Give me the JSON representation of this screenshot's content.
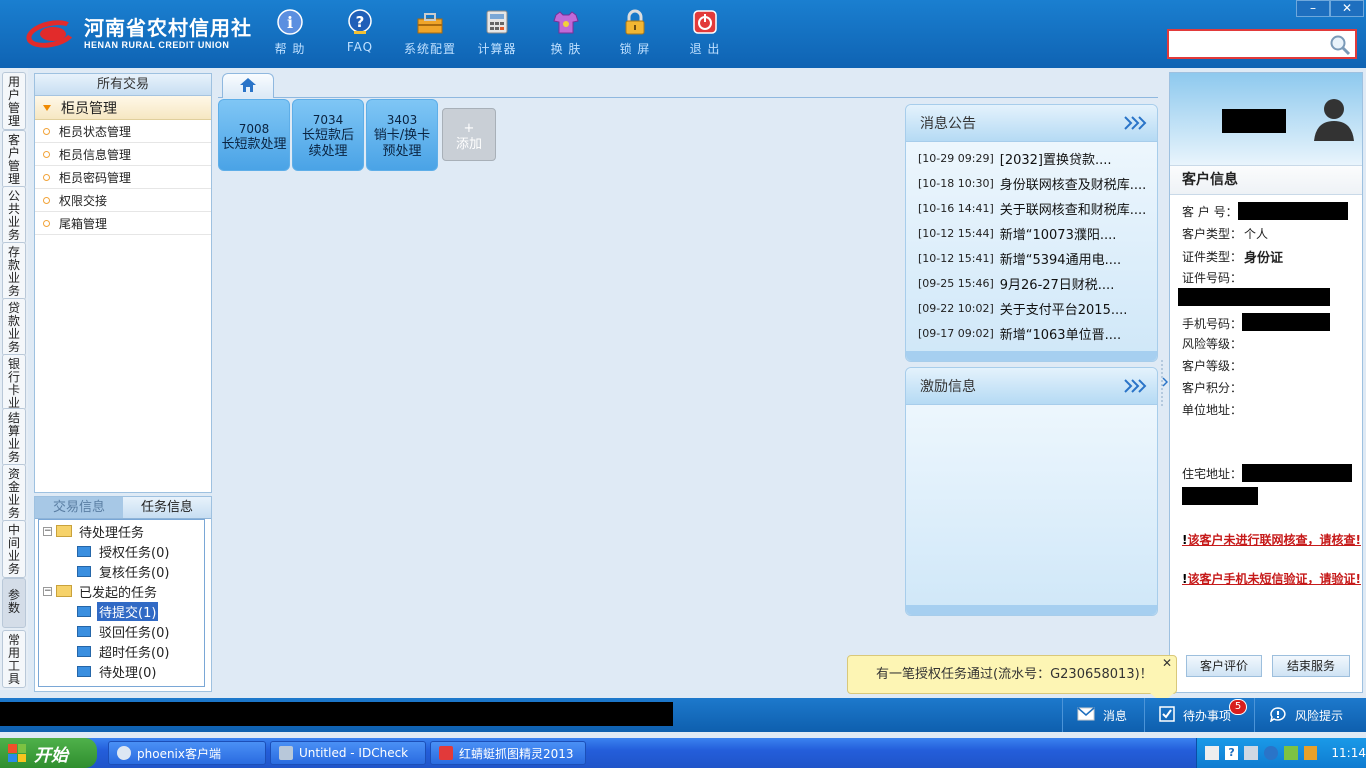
{
  "header": {
    "logo_cn": "河南省农村信用社",
    "logo_en": "HENAN RURAL CREDIT UNION",
    "tools": [
      {
        "label": "帮 助",
        "icon": "info-icon"
      },
      {
        "label": "FAQ",
        "icon": "help-icon"
      },
      {
        "label": "系统配置",
        "icon": "toolbox-icon"
      },
      {
        "label": "计算器",
        "icon": "calculator-icon"
      },
      {
        "label": "换 肤",
        "icon": "shirt-icon"
      },
      {
        "label": "锁 屏",
        "icon": "lock-icon"
      },
      {
        "label": "退 出",
        "icon": "power-icon"
      }
    ],
    "minimize": "–",
    "close": "✕",
    "search_value": ""
  },
  "vtabs": [
    "用户管理",
    "客户管理",
    "公共业务",
    "存款业务",
    "贷款业务",
    "银行卡业务",
    "结算业务",
    "资金业务",
    "中间业务",
    "参数",
    "常用工具"
  ],
  "left_menu": {
    "header": "所有交易",
    "group": "柜员管理",
    "items": [
      "柜员状态管理",
      "柜员信息管理",
      "柜员密码管理",
      "权限交接",
      "尾箱管理"
    ]
  },
  "tasks": {
    "tab_tx": "交易信息",
    "tab_task": "任务信息",
    "pending": "待处理任务",
    "auth": "授权任务(0)",
    "review": "复核任务(0)",
    "initiated": "已发起的任务",
    "to_submit": "待提交(1)",
    "rejected": "驳回任务(0)",
    "timeout": "超时任务(0)",
    "to_process": "待处理(0)"
  },
  "tiles": [
    {
      "code": "7008",
      "name": "长短款处理"
    },
    {
      "code": "7034",
      "name": "长短款后续处理"
    },
    {
      "code": "3403",
      "name": "销卡/换卡预处理"
    }
  ],
  "add_tile": {
    "plus": "+",
    "label": "添加"
  },
  "notices": {
    "title": "消息公告",
    "items": [
      {
        "date": "[10-29 09:29]",
        "text": "[2032]置换贷款...."
      },
      {
        "date": "[10-18 10:30]",
        "text": "身份联网核查及财税库...."
      },
      {
        "date": "[10-16 14:41]",
        "text": "关于联网核查和财税库...."
      },
      {
        "date": "[10-12 15:44]",
        "text": "新增“10073濮阳...."
      },
      {
        "date": "[10-12 15:41]",
        "text": "新增“5394通用电...."
      },
      {
        "date": "[09-25 15:46]",
        "text": "9月26-27日财税...."
      },
      {
        "date": "[09-22 10:02]",
        "text": "关于支付平台2015...."
      },
      {
        "date": "[09-17 09:02]",
        "text": "新增“1063单位晋...."
      }
    ]
  },
  "incentive": {
    "title": "激励信息"
  },
  "customer": {
    "title": "客户信息",
    "no_label": "客 户 号：",
    "type_label": "客户类型：",
    "type_value": "个人",
    "id_type_label": "证件类型：",
    "id_type_value": "身份证",
    "id_no_label": "证件号码：",
    "phone_label": "手机号码：",
    "risk_label": "风险等级：",
    "level_label": "客户等级：",
    "points_label": "客户积分：",
    "work_addr_label": "单位地址：",
    "home_addr_label": "住宅地址：",
    "warn1": "该客户未进行联网核查，请核查",
    "warn2": "该客户手机未短信验证，请验证",
    "excl": "!",
    "bang": "!",
    "eval_btn": "客户评价",
    "end_btn": "结束服务"
  },
  "toast": {
    "text": "有一笔授权任务通过(流水号：G230658013)！",
    "close": "✕"
  },
  "statusbar": {
    "msg": "消息",
    "todo": "待办事项",
    "todo_count": "5",
    "risk": "风险提示"
  },
  "taskbar": {
    "start": "开始",
    "apps": [
      "phoenix客户端",
      "Untitled - IDCheck",
      "红蜻蜓抓图精灵2013"
    ],
    "time": "11:14"
  }
}
